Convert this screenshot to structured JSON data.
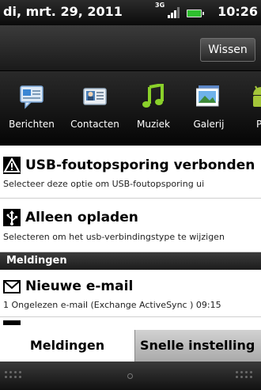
{
  "status_bar": {
    "date": "di, mrt. 29, 2011",
    "network": "3G",
    "time": "10:26",
    "accent_battery": "#2fbf2f"
  },
  "toolbar": {
    "clear_label": "Wissen"
  },
  "apps": [
    {
      "label": "Berichten",
      "icon": "messages-icon"
    },
    {
      "label": "Contacten",
      "icon": "contacts-icon"
    },
    {
      "label": "Muziek",
      "icon": "music-icon"
    },
    {
      "label": "Galerij",
      "icon": "gallery-icon"
    },
    {
      "label": "P",
      "icon": "android-icon"
    }
  ],
  "notifications": [
    {
      "title": "USB-foutopsporing verbonden",
      "subtitle": "Selecteer deze optie om USB-foutopsporing ui",
      "icon": "warning-icon"
    },
    {
      "title": "Alleen opladen",
      "subtitle": "Selecteren om het usb-verbindingstype te wijzigen",
      "icon": "usb-icon"
    }
  ],
  "section_header": "Meldingen",
  "mail": {
    "title": "Nieuwe e-mail",
    "subtitle": "1 Ongelezen e-mail (Exchange ActiveSync ) 09:15",
    "icon": "mail-icon"
  },
  "tabs": {
    "active": "Meldingen",
    "inactive": "Snelle instelling"
  }
}
